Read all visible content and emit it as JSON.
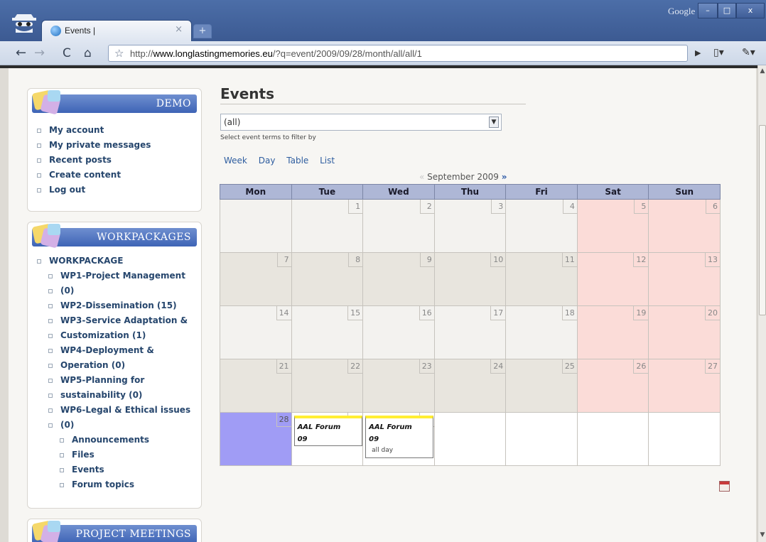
{
  "browser": {
    "tab_title": "Events |",
    "tab_close": "×",
    "new_tab": "+",
    "google_label": "Google",
    "window_minimize": "–",
    "window_maximize": "□",
    "window_close": "x",
    "url_prefix": "http://",
    "url_host": "www.longlastingmemories.eu",
    "url_path": "/?q=event/2009/09/28/month/all/all/1"
  },
  "sidebar": {
    "demo_block": {
      "title": "DEMO",
      "items": [
        "My account",
        "My private messages",
        "Recent posts",
        "Create content",
        "Log out"
      ]
    },
    "workpackages_block": {
      "title": "WORKPACKAGES",
      "root": "WORKPACKAGE",
      "items": [
        "WP1-Project Management",
        "(0)",
        "WP2-Dissemination (15)",
        "WP3-Service Adaptation &",
        "Customization (1)",
        "WP4-Deployment &",
        "Operation (0)",
        "WP5-Planning for",
        "sustainability (0)",
        "WP6-Legal & Ethical issues",
        "(0)"
      ],
      "sub_items": [
        "Announcements",
        "Files",
        "Events",
        "Forum topics"
      ]
    },
    "meetings_block": {
      "title": "PROJECT MEETINGS"
    }
  },
  "main": {
    "title": "Events",
    "filter_value": "(all)",
    "filter_description": "Select event terms to filter by",
    "view_links": [
      "Week",
      "Day",
      "Table",
      "List"
    ],
    "month_label": "September 2009",
    "prev_arrow": "«",
    "next_arrow": "»",
    "weekdays": [
      "Mon",
      "Tue",
      "Wed",
      "Thu",
      "Fri",
      "Sat",
      "Sun"
    ],
    "weeks": [
      [
        "",
        "1",
        "2",
        "3",
        "4",
        "5",
        "6"
      ],
      [
        "7",
        "8",
        "9",
        "10",
        "11",
        "12",
        "13"
      ],
      [
        "14",
        "15",
        "16",
        "17",
        "18",
        "19",
        "20"
      ],
      [
        "21",
        "22",
        "23",
        "24",
        "25",
        "26",
        "27"
      ],
      [
        "28",
        "29",
        "30",
        "",
        "",
        "",
        ""
      ]
    ],
    "events": [
      {
        "day": "29",
        "title": "AAL Forum 09",
        "time": ""
      },
      {
        "day": "30",
        "title": "AAL Forum 09",
        "time": "all day"
      }
    ]
  },
  "colors": {
    "header_blue": "#3e64b6",
    "weekday_header": "#aeb7d6",
    "weekend": "#fbdcd8",
    "today": "#a09cf5",
    "event_bar": "#ffee33",
    "link": "#26466d"
  }
}
